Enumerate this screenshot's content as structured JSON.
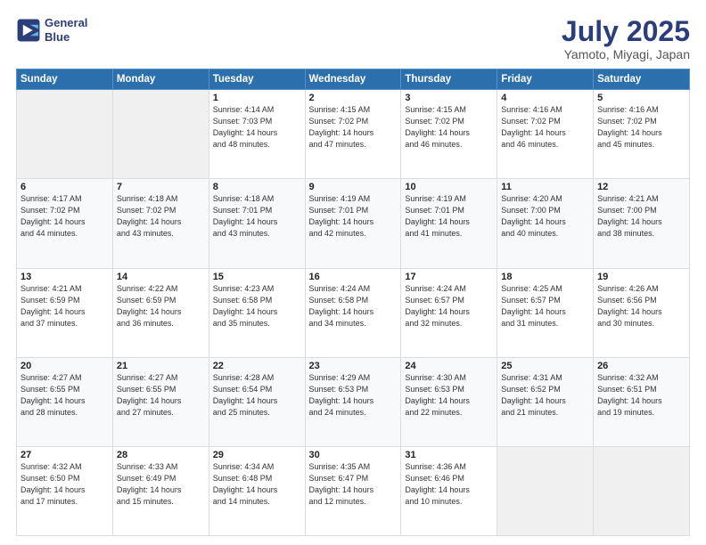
{
  "header": {
    "logo_line1": "General",
    "logo_line2": "Blue",
    "title": "July 2025",
    "subtitle": "Yamoto, Miyagi, Japan"
  },
  "days_of_week": [
    "Sunday",
    "Monday",
    "Tuesday",
    "Wednesday",
    "Thursday",
    "Friday",
    "Saturday"
  ],
  "weeks": [
    [
      {
        "day": "",
        "info": ""
      },
      {
        "day": "",
        "info": ""
      },
      {
        "day": "1",
        "info": "Sunrise: 4:14 AM\nSunset: 7:03 PM\nDaylight: 14 hours\nand 48 minutes."
      },
      {
        "day": "2",
        "info": "Sunrise: 4:15 AM\nSunset: 7:02 PM\nDaylight: 14 hours\nand 47 minutes."
      },
      {
        "day": "3",
        "info": "Sunrise: 4:15 AM\nSunset: 7:02 PM\nDaylight: 14 hours\nand 46 minutes."
      },
      {
        "day": "4",
        "info": "Sunrise: 4:16 AM\nSunset: 7:02 PM\nDaylight: 14 hours\nand 46 minutes."
      },
      {
        "day": "5",
        "info": "Sunrise: 4:16 AM\nSunset: 7:02 PM\nDaylight: 14 hours\nand 45 minutes."
      }
    ],
    [
      {
        "day": "6",
        "info": "Sunrise: 4:17 AM\nSunset: 7:02 PM\nDaylight: 14 hours\nand 44 minutes."
      },
      {
        "day": "7",
        "info": "Sunrise: 4:18 AM\nSunset: 7:02 PM\nDaylight: 14 hours\nand 43 minutes."
      },
      {
        "day": "8",
        "info": "Sunrise: 4:18 AM\nSunset: 7:01 PM\nDaylight: 14 hours\nand 43 minutes."
      },
      {
        "day": "9",
        "info": "Sunrise: 4:19 AM\nSunset: 7:01 PM\nDaylight: 14 hours\nand 42 minutes."
      },
      {
        "day": "10",
        "info": "Sunrise: 4:19 AM\nSunset: 7:01 PM\nDaylight: 14 hours\nand 41 minutes."
      },
      {
        "day": "11",
        "info": "Sunrise: 4:20 AM\nSunset: 7:00 PM\nDaylight: 14 hours\nand 40 minutes."
      },
      {
        "day": "12",
        "info": "Sunrise: 4:21 AM\nSunset: 7:00 PM\nDaylight: 14 hours\nand 38 minutes."
      }
    ],
    [
      {
        "day": "13",
        "info": "Sunrise: 4:21 AM\nSunset: 6:59 PM\nDaylight: 14 hours\nand 37 minutes."
      },
      {
        "day": "14",
        "info": "Sunrise: 4:22 AM\nSunset: 6:59 PM\nDaylight: 14 hours\nand 36 minutes."
      },
      {
        "day": "15",
        "info": "Sunrise: 4:23 AM\nSunset: 6:58 PM\nDaylight: 14 hours\nand 35 minutes."
      },
      {
        "day": "16",
        "info": "Sunrise: 4:24 AM\nSunset: 6:58 PM\nDaylight: 14 hours\nand 34 minutes."
      },
      {
        "day": "17",
        "info": "Sunrise: 4:24 AM\nSunset: 6:57 PM\nDaylight: 14 hours\nand 32 minutes."
      },
      {
        "day": "18",
        "info": "Sunrise: 4:25 AM\nSunset: 6:57 PM\nDaylight: 14 hours\nand 31 minutes."
      },
      {
        "day": "19",
        "info": "Sunrise: 4:26 AM\nSunset: 6:56 PM\nDaylight: 14 hours\nand 30 minutes."
      }
    ],
    [
      {
        "day": "20",
        "info": "Sunrise: 4:27 AM\nSunset: 6:55 PM\nDaylight: 14 hours\nand 28 minutes."
      },
      {
        "day": "21",
        "info": "Sunrise: 4:27 AM\nSunset: 6:55 PM\nDaylight: 14 hours\nand 27 minutes."
      },
      {
        "day": "22",
        "info": "Sunrise: 4:28 AM\nSunset: 6:54 PM\nDaylight: 14 hours\nand 25 minutes."
      },
      {
        "day": "23",
        "info": "Sunrise: 4:29 AM\nSunset: 6:53 PM\nDaylight: 14 hours\nand 24 minutes."
      },
      {
        "day": "24",
        "info": "Sunrise: 4:30 AM\nSunset: 6:53 PM\nDaylight: 14 hours\nand 22 minutes."
      },
      {
        "day": "25",
        "info": "Sunrise: 4:31 AM\nSunset: 6:52 PM\nDaylight: 14 hours\nand 21 minutes."
      },
      {
        "day": "26",
        "info": "Sunrise: 4:32 AM\nSunset: 6:51 PM\nDaylight: 14 hours\nand 19 minutes."
      }
    ],
    [
      {
        "day": "27",
        "info": "Sunrise: 4:32 AM\nSunset: 6:50 PM\nDaylight: 14 hours\nand 17 minutes."
      },
      {
        "day": "28",
        "info": "Sunrise: 4:33 AM\nSunset: 6:49 PM\nDaylight: 14 hours\nand 15 minutes."
      },
      {
        "day": "29",
        "info": "Sunrise: 4:34 AM\nSunset: 6:48 PM\nDaylight: 14 hours\nand 14 minutes."
      },
      {
        "day": "30",
        "info": "Sunrise: 4:35 AM\nSunset: 6:47 PM\nDaylight: 14 hours\nand 12 minutes."
      },
      {
        "day": "31",
        "info": "Sunrise: 4:36 AM\nSunset: 6:46 PM\nDaylight: 14 hours\nand 10 minutes."
      },
      {
        "day": "",
        "info": ""
      },
      {
        "day": "",
        "info": ""
      }
    ]
  ]
}
